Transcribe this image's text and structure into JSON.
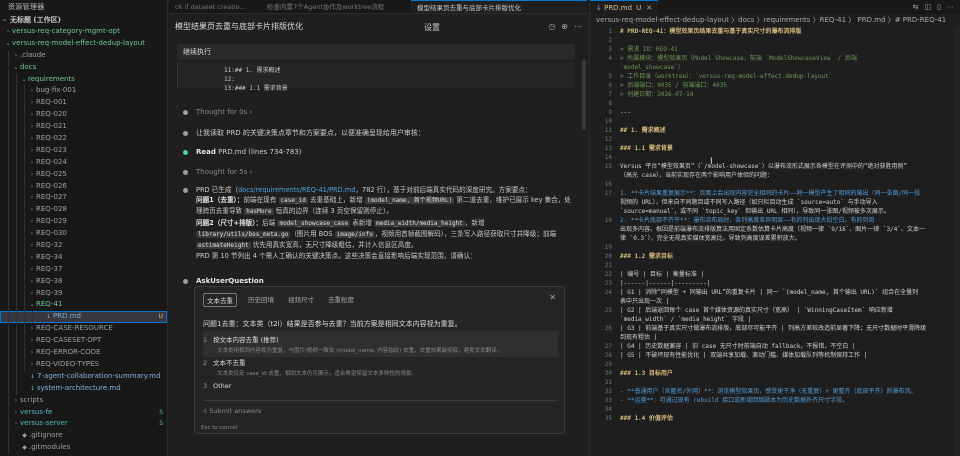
{
  "explorer": {
    "title": "资源管理器",
    "workspace": "无标题 (工作区)",
    "rows": [
      {
        "label": "versus-req-category-mgmt-opt",
        "depth": 0,
        "arrow": "›",
        "color": "green",
        "badge": ""
      },
      {
        "label": "versus-req-model-effect-dedup-layout",
        "depth": 0,
        "arrow": "⌄",
        "color": "green",
        "badge": ""
      },
      {
        "label": ".claude",
        "depth": 1,
        "arrow": "›",
        "color": "gray",
        "badge": ""
      },
      {
        "label": "docs",
        "depth": 1,
        "arrow": "⌄",
        "color": "green",
        "badge": ""
      },
      {
        "label": "requirements",
        "depth": 2,
        "arrow": "⌄",
        "color": "green",
        "badge": ""
      },
      {
        "label": "bug-fix-001",
        "depth": 3,
        "arrow": "›",
        "color": "gray",
        "badge": ""
      },
      {
        "label": "REQ-001",
        "depth": 3,
        "arrow": "›",
        "color": "gray",
        "badge": ""
      },
      {
        "label": "REQ-020",
        "depth": 3,
        "arrow": "›",
        "color": "gray",
        "badge": ""
      },
      {
        "label": "REQ-021",
        "depth": 3,
        "arrow": "›",
        "color": "gray",
        "badge": ""
      },
      {
        "label": "REQ-022",
        "depth": 3,
        "arrow": "›",
        "color": "gray",
        "badge": ""
      },
      {
        "label": "REQ-023",
        "depth": 3,
        "arrow": "›",
        "color": "gray",
        "badge": ""
      },
      {
        "label": "REQ-024",
        "depth": 3,
        "arrow": "›",
        "color": "gray",
        "badge": ""
      },
      {
        "label": "REQ-025",
        "depth": 3,
        "arrow": "›",
        "color": "gray",
        "badge": ""
      },
      {
        "label": "REQ-026",
        "depth": 3,
        "arrow": "›",
        "color": "gray",
        "badge": ""
      },
      {
        "label": "REQ-027",
        "depth": 3,
        "arrow": "›",
        "color": "gray",
        "badge": ""
      },
      {
        "label": "REQ-028",
        "depth": 3,
        "arrow": "›",
        "color": "gray",
        "badge": ""
      },
      {
        "label": "REQ-029",
        "depth": 3,
        "arrow": "›",
        "color": "gray",
        "badge": ""
      },
      {
        "label": "REQ-030",
        "depth": 3,
        "arrow": "›",
        "color": "gray",
        "badge": ""
      },
      {
        "label": "REQ-32",
        "depth": 3,
        "arrow": "›",
        "color": "gray",
        "badge": ""
      },
      {
        "label": "REQ-34",
        "depth": 3,
        "arrow": "›",
        "color": "gray",
        "badge": ""
      },
      {
        "label": "REQ-37",
        "depth": 3,
        "arrow": "›",
        "color": "gray",
        "badge": ""
      },
      {
        "label": "REQ-38",
        "depth": 3,
        "arrow": "›",
        "color": "gray",
        "badge": ""
      },
      {
        "label": "REQ-39",
        "depth": 3,
        "arrow": "›",
        "color": "gray",
        "badge": ""
      },
      {
        "label": "REQ-41",
        "depth": 3,
        "arrow": "⌄",
        "color": "green",
        "badge": ""
      },
      {
        "label": "PRD.md",
        "depth": 4,
        "arrow": "",
        "color": "blue",
        "badge": "U",
        "selected": true,
        "file": true
      },
      {
        "label": "REQ-CASE-RESOURCE",
        "depth": 3,
        "arrow": "›",
        "color": "gray",
        "badge": ""
      },
      {
        "label": "REQ-CASESET-OPT",
        "depth": 3,
        "arrow": "›",
        "color": "gray",
        "badge": ""
      },
      {
        "label": "REQ-ERROR-CODE",
        "depth": 3,
        "arrow": "›",
        "color": "gray",
        "badge": ""
      },
      {
        "label": "REQ-VIDEO-TYPES",
        "depth": 3,
        "arrow": "›",
        "color": "gray",
        "badge": ""
      },
      {
        "label": "7-agent-collaboration-summary.md",
        "depth": 2,
        "arrow": "",
        "color": "blue",
        "badge": "",
        "file": true
      },
      {
        "label": "system-architecture.md",
        "depth": 2,
        "arrow": "",
        "color": "blue",
        "badge": "",
        "file": true
      },
      {
        "label": "scripts",
        "depth": 1,
        "arrow": "›",
        "color": "gray",
        "badge": ""
      },
      {
        "label": "versus-fe",
        "depth": 1,
        "arrow": "›",
        "color": "teal",
        "badge": "S"
      },
      {
        "label": "versus-server",
        "depth": 1,
        "arrow": "›",
        "color": "teal",
        "badge": "S"
      },
      {
        "label": ".gitignore",
        "depth": 1,
        "arrow": "",
        "color": "gray",
        "badge": "",
        "file": true
      },
      {
        "label": ".gitmodules",
        "depth": 1,
        "arrow": "",
        "color": "gray",
        "badge": "",
        "file": true
      }
    ]
  },
  "middle": {
    "tabs": [
      "ck if dataset creatio...",
      "检查内置7个Agent协作及worktree流程",
      "模型结果页去重与底部卡片排版优化"
    ],
    "title": "模型结果页去重与底部卡片排版优化",
    "settings": "设置",
    "continue": "继续执行",
    "code_lines": [
      "11:## 1. 需求概述",
      "12:",
      "13:### 1.1 需求背景"
    ],
    "thought1": "Thought for 0s",
    "msg1": "让我读取 PRD 的关键决策点章节和方案要点，以便准确呈现给用户审核：",
    "read_label": "Read",
    "read_file": "PRD.md (lines 734-783)",
    "thought2": "Thought for 5s",
    "summary_pre": "PRD 已生成（",
    "summary_link": "docs/requirements/REQ-41/PRD.md",
    "summary_post": "，782 行），基于对前后端真实代码的深度研究。方案要点：",
    "q1_head": "问题1（去重）：",
    "q1_a": "前端在现有",
    "q1_code1": "case_id",
    "q1_b": "去重基础上，新增",
    "q1_code2": "(model_name, 首个视频URL)",
    "q1_c": "第二道去重，维护已展示 key 集合，处理跨页去重导致",
    "q1_code3": "hasMore",
    "q1_d": "恒真的边界（连续 3 页空保留则停止）。",
    "q2_head": "问题2（尺寸+排版）：",
    "q2_a": "后端",
    "q2_code1": "model_showcase_case",
    "q2_b": "表新增",
    "q2_code2": "media_width/media_height",
    "q2_c": "，新增",
    "q2_code3": "library/utils/bos_meta.go",
    "q2_d": "（图片用 BOS",
    "q2_code4": "image/info",
    "q2_e": "，视频用首帧截图解码），三条写入路径获取尺寸并降级；前端",
    "q2_code5": "estimateHeight",
    "q2_f": "优先用真实宽高，无尺寸降级粗估，并计入信息区高度。",
    "prd_line": "PRD 第 10 节列出 4 个需人工确认的关键决策点。这些决策会直接影响后端实现范围，请确认：",
    "ask_label": "AskUserQuestion",
    "aq_tabs": [
      "文本去重",
      "历史回填",
      "视频尺寸",
      "去重粒度"
    ],
    "aq_question": "问题1去重：文本类（t2i）结果是否参与去重？当前方案是相同文本内容视为重复。",
    "options": [
      {
        "num": "1",
        "label": "按文本内容去重 (推荐)",
        "desc": "文本类用相同内容视为重复，与图片/视频一致去 (model_name, 内容指纹) 去重，去重效果最彻底，避免文本翻译。"
      },
      {
        "num": "2",
        "label": "文本不去重",
        "desc": "文本类仅走 case_id 去重，相同文本仍可展示，适合希望保留文本多样性的场景。"
      },
      {
        "num": "3",
        "label": "Other",
        "desc": ""
      }
    ],
    "submit": "Submit answers",
    "esc": "Esc to cancel"
  },
  "right": {
    "tab": "PRD.md",
    "tab_status": "U",
    "breadcrumb": "versus-req-model-effect-dedup-layout 〉docs 〉requirements 〉REQ-41 〉 PRD.md 〉# PRD-REQ-41",
    "lines": [
      {
        "n": "1",
        "t": "# PRD-REQ-41：模型效果页结果去重与基于真实尺寸的瀑布流排版",
        "k": "h"
      },
      {
        "n": "2",
        "t": "",
        "k": ""
      },
      {
        "n": "3",
        "t": "> 需求 ID：REQ-41",
        "k": "q"
      },
      {
        "n": "4",
        "t": "> 所属模块：模型效果页（Model Showcase，前端 `ModelShowcaseView` / 后端",
        "k": "q"
      },
      {
        "n": "",
        "t": "`model_showcase`）",
        "k": "q"
      },
      {
        "n": "5",
        "t": "> 工作目录（worktree）：`versus-req-model-effect-dedup-layout`",
        "k": "q"
      },
      {
        "n": "6",
        "t": "> 后端端口：9035 / 前端端口：4035",
        "k": "q"
      },
      {
        "n": "7",
        "t": "> 创建日期：2026-07-14",
        "k": "q"
      },
      {
        "n": "8",
        "t": "",
        "k": ""
      },
      {
        "n": "9",
        "t": "---",
        "k": ""
      },
      {
        "n": "10",
        "t": "",
        "k": ""
      },
      {
        "n": "11",
        "t": "## 1. 需求概述",
        "k": "h"
      },
      {
        "n": "12",
        "t": "",
        "k": ""
      },
      {
        "n": "13",
        "t": "### 1.1 需求背景",
        "k": "h"
      },
      {
        "n": "14",
        "t": "",
        "k": ""
      },
      {
        "n": "15",
        "t": "Versus 平台“模型效果页”（`/model-showcase`）以瀑布流形式展示各模型在评测中的“绝对获胜用例”",
        "k": ""
      },
      {
        "n": "",
        "t": "（高光 case），当前实现存在两个影响用户体验的问题：",
        "k": ""
      },
      {
        "n": "16",
        "t": "",
        "k": ""
      },
      {
        "n": "17",
        "t": "1. **卡片结果重复展示**：页面上会出现内容完全相同的卡片——同一模型产生了相同的输出（同一张图/同一段",
        "k": "b"
      },
      {
        "n": "",
        "t": "视频的 URL），但来自不同题目或不同写入路径（如只栏目动生成 `source=auto` 与手动导入",
        "k": ""
      },
      {
        "n": "",
        "t": "`source=manual`，或不同 `topic_key` 但输出 URL 相同），导致同一张图/视频被多次展示。",
        "k": ""
      },
      {
        "n": "18",
        "t": "2. **卡片底部不齐平**：瀑布流布局时，各列高度差异明显——有的列出现大段空白，有的列则",
        "k": "b"
      },
      {
        "n": "",
        "t": "出现多内容。根因是前端瀑布流排版算法用固定系数估算卡片高度（视频一律 `9/16`、图片一律 `3/4`、文本一",
        "k": ""
      },
      {
        "n": "",
        "t": "律 `0.3`），完全无视真实媒体宽高比，导致列高度误差累积放大。",
        "k": ""
      },
      {
        "n": "19",
        "t": "",
        "k": ""
      },
      {
        "n": "20",
        "t": "### 1.2 需求目标",
        "k": "h"
      },
      {
        "n": "21",
        "t": "",
        "k": ""
      },
      {
        "n": "22",
        "t": "| 编号 | 目标 | 衡量标准 |",
        "k": ""
      },
      {
        "n": "23",
        "t": "|------|------|---------|",
        "k": ""
      },
      {
        "n": "24",
        "t": "| G1 | 消除“同模型 + 同输出 URL”的重复卡片 | 同一 `(model_name, 首个输出 URL)` 组合在全量列",
        "k": ""
      },
      {
        "n": "",
        "t": "表中只出现一次 |",
        "k": ""
      },
      {
        "n": "25",
        "t": "| G2 | 后端返回每个 case 首个媒体资源的真实尺寸（宽高） | `WinningCaseItem` 响应新增",
        "k": ""
      },
      {
        "n": "",
        "t": "`media_width` / `media_height` 字段 |",
        "k": ""
      },
      {
        "n": "26",
        "t": "| G3 | 前端基于真实尺寸做瀑布流排版，底部尽可能平齐 | 列高方差较改造前显著下降；无尺寸数据时平滑降级",
        "k": ""
      },
      {
        "n": "",
        "t": "到现有粗估 |",
        "k": ""
      },
      {
        "n": "27",
        "t": "| G4 | 历史数据兼容 | 旧 case 无尺寸时前端自动 fallback，不报错，不空白 |",
        "k": ""
      },
      {
        "n": "28",
        "t": "| G5 | 不破坏现有性能优化 | 双端共享加载、滚动门槛、媒体加载队列等机制保持工作 |",
        "k": ""
      },
      {
        "n": "29",
        "t": "",
        "k": ""
      },
      {
        "n": "30",
        "t": "### 1.3 目标用户",
        "k": "h"
      },
      {
        "n": "31",
        "t": "",
        "k": ""
      },
      {
        "n": "32",
        "t": "- **普通用户（含匿名/外网）**：浏览模型效果页，感受更干净（无重复）+ 更整齐（底部平齐）的瀑布流。",
        "k": "b"
      },
      {
        "n": "33",
        "t": "- **运营**：可通过现有 rebuild 接口或新增回填脚本为历史数据补齐尺寸字段。",
        "k": "b"
      },
      {
        "n": "34",
        "t": "",
        "k": ""
      },
      {
        "n": "35",
        "t": "### 1.4 价值评估",
        "k": "h"
      }
    ]
  }
}
